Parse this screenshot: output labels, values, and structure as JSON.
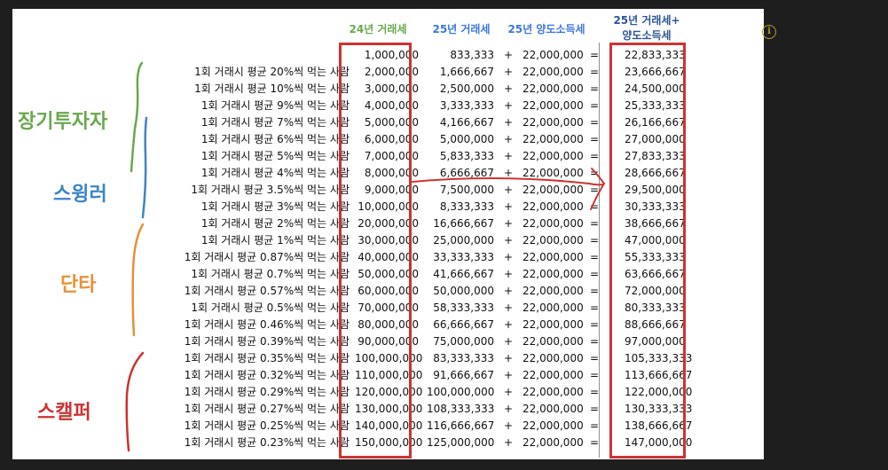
{
  "headers": {
    "col24": "24년 거래세",
    "col25": "25년 거래세",
    "colTax": "25년 양도소득세",
    "colTotal1": "25년 거래세+",
    "colTotal2": "양도소득세"
  },
  "groups": {
    "long": "장기투자자",
    "swing": "스윙러",
    "short": "단타",
    "scalp": "스캘퍼"
  },
  "colors": {
    "long": "#6aa84f",
    "swing": "#3d85c6",
    "short": "#e69138",
    "scalp": "#cc3333"
  },
  "rows": [
    {
      "label": "",
      "v24": "1,000,000",
      "v25": "833,333",
      "plus": "+",
      "tax": "22,000,000",
      "eq": "=",
      "total": "22,833,333"
    },
    {
      "label": "1회 거래시 평균 20%씩 먹는 사람",
      "v24": "2,000,000",
      "v25": "1,666,667",
      "plus": "+",
      "tax": "22,000,000",
      "eq": "=",
      "total": "23,666,667"
    },
    {
      "label": "1회 거래시 평균 10%씩 먹는 사람",
      "v24": "3,000,000",
      "v25": "2,500,000",
      "plus": "+",
      "tax": "22,000,000",
      "eq": "=",
      "total": "24,500,000"
    },
    {
      "label": "1회 거래시 평균 9%씩 먹는 사람",
      "v24": "4,000,000",
      "v25": "3,333,333",
      "plus": "+",
      "tax": "22,000,000",
      "eq": "=",
      "total": "25,333,333"
    },
    {
      "label": "1회 거래시 평균 7%씩 먹는 사람",
      "v24": "5,000,000",
      "v25": "4,166,667",
      "plus": "+",
      "tax": "22,000,000",
      "eq": "=",
      "total": "26,166,667"
    },
    {
      "label": "1회 거래시 평균 6%씩 먹는 사람",
      "v24": "6,000,000",
      "v25": "5,000,000",
      "plus": "+",
      "tax": "22,000,000",
      "eq": "=",
      "total": "27,000,000"
    },
    {
      "label": "1회 거래시 평균 5%씩 먹는 사람",
      "v24": "7,000,000",
      "v25": "5,833,333",
      "plus": "+",
      "tax": "22,000,000",
      "eq": "=",
      "total": "27,833,333"
    },
    {
      "label": "1회 거래시 평균 4%씩 먹는 사람",
      "v24": "8,000,000",
      "v25": "6,666,667",
      "plus": "+",
      "tax": "22,000,000",
      "eq": "=",
      "total": "28,666,667"
    },
    {
      "label": "1회 거래시 평균 3.5%씩 먹는 사람",
      "v24": "9,000,000",
      "v25": "7,500,000",
      "plus": "+",
      "tax": "22,000,000",
      "eq": "=",
      "total": "29,500,000"
    },
    {
      "label": "1회 거래시 평균 3%씩 먹는 사람",
      "v24": "10,000,000",
      "v25": "8,333,333",
      "plus": "+",
      "tax": "22,000,000",
      "eq": "=",
      "total": "30,333,333"
    },
    {
      "label": "1회 거래시 평균 2%씩 먹는 사람",
      "v24": "20,000,000",
      "v25": "16,666,667",
      "plus": "+",
      "tax": "22,000,000",
      "eq": "=",
      "total": "38,666,667"
    },
    {
      "label": "1회 거래시 평균 1%씩 먹는 사람",
      "v24": "30,000,000",
      "v25": "25,000,000",
      "plus": "+",
      "tax": "22,000,000",
      "eq": "=",
      "total": "47,000,000"
    },
    {
      "label": "1회 거래시 평균 0.87%씩 먹는 사람",
      "v24": "40,000,000",
      "v25": "33,333,333",
      "plus": "+",
      "tax": "22,000,000",
      "eq": "=",
      "total": "55,333,333"
    },
    {
      "label": "1회 거래시 평균 0.7%씩 먹는 사람",
      "v24": "50,000,000",
      "v25": "41,666,667",
      "plus": "+",
      "tax": "22,000,000",
      "eq": "=",
      "total": "63,666,667"
    },
    {
      "label": "1회 거래시 평균 0.57%씩 먹는 사람",
      "v24": "60,000,000",
      "v25": "50,000,000",
      "plus": "+",
      "tax": "22,000,000",
      "eq": "=",
      "total": "72,000,000"
    },
    {
      "label": "1회 거래시 평균 0.5%씩 먹는 사람",
      "v24": "70,000,000",
      "v25": "58,333,333",
      "plus": "+",
      "tax": "22,000,000",
      "eq": "=",
      "total": "80,333,333"
    },
    {
      "label": "1회 거래시 평균 0.46%씩 먹는 사람",
      "v24": "80,000,000",
      "v25": "66,666,667",
      "plus": "+",
      "tax": "22,000,000",
      "eq": "=",
      "total": "88,666,667"
    },
    {
      "label": "1회 거래시 평균 0.39%씩 먹는 사람",
      "v24": "90,000,000",
      "v25": "75,000,000",
      "plus": "+",
      "tax": "22,000,000",
      "eq": "=",
      "total": "97,000,000"
    },
    {
      "label": "1회 거래시 평균 0.35%씩 먹는 사람",
      "v24": "100,000,000",
      "v25": "83,333,333",
      "plus": "+",
      "tax": "22,000,000",
      "eq": "=",
      "total": "105,333,333"
    },
    {
      "label": "1회 거래시 평균 0.32%씩 먹는 사람",
      "v24": "110,000,000",
      "v25": "91,666,667",
      "plus": "+",
      "tax": "22,000,000",
      "eq": "=",
      "total": "113,666,667"
    },
    {
      "label": "1회 거래시 평균 0.29%씩 먹는 사람",
      "v24": "120,000,000",
      "v25": "100,000,000",
      "plus": "+",
      "tax": "22,000,000",
      "eq": "=",
      "total": "122,000,000"
    },
    {
      "label": "1회 거래시 평균 0.27%씩 먹는 사람",
      "v24": "130,000,000",
      "v25": "108,333,333",
      "plus": "+",
      "tax": "22,000,000",
      "eq": "=",
      "total": "130,333,333"
    },
    {
      "label": "1회 거래시 평균 0.25%씩 먹는 사람",
      "v24": "140,000,000",
      "v25": "116,666,667",
      "plus": "+",
      "tax": "22,000,000",
      "eq": "=",
      "total": "138,666,667"
    },
    {
      "label": "1회 거래시 평균 0.23%씩 먹는 사람",
      "v24": "150,000,000",
      "v25": "125,000,000",
      "plus": "+",
      "tax": "22,000,000",
      "eq": "=",
      "total": "147,000,000"
    }
  ]
}
